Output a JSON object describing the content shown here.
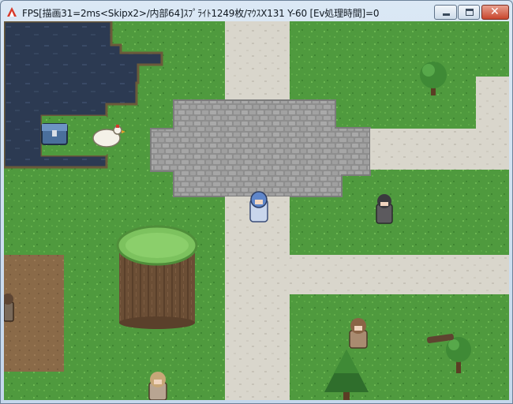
{
  "window": {
    "title": "FPS[描画31=2ms<Skipx2>/内部64]ｽﾌﾟﾗｲﾄ1249枚/ﾏｳｽX131 Y-60 [Ev処理時間]=0",
    "controls": {
      "minimize_icon": "minimize-icon",
      "maximize_icon": "maximize-icon",
      "close_icon": "close-icon",
      "close_glyph": "✕"
    }
  },
  "colors": {
    "grass": "#4f9a3e",
    "grass_light": "#66b24d",
    "path": "#d9d6cc",
    "cobble": "#9a9a9a",
    "water": "#2c3a52",
    "dirt": "#8a6a48",
    "tree_bark": "#6b4e35"
  },
  "scene": {
    "characters": [
      "player-blue-hair",
      "npc-dark-hair",
      "npc-brown-hair",
      "npc-blonde",
      "npc-left-edge"
    ],
    "objects": [
      "treasure-chest",
      "chicken",
      "tree-stump",
      "small-tree",
      "pine-tree",
      "fallen-log"
    ]
  }
}
